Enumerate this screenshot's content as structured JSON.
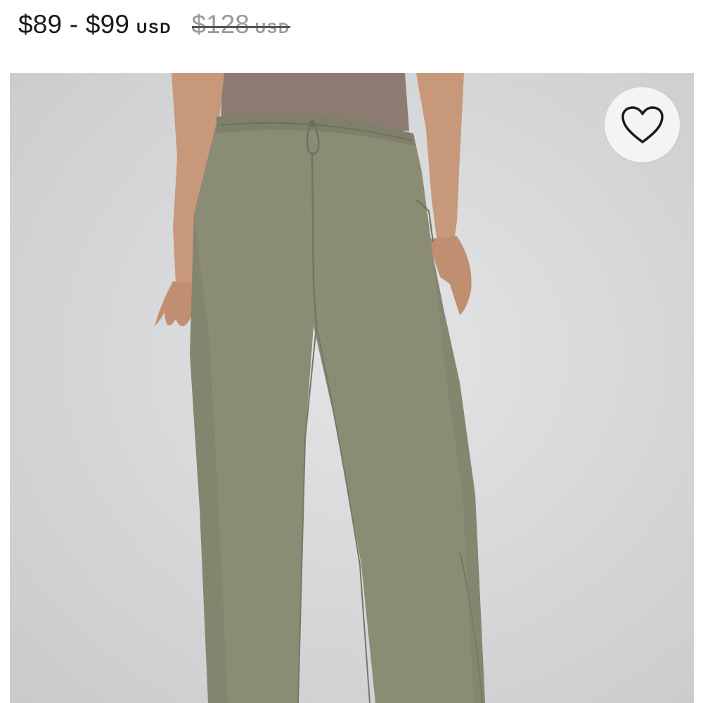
{
  "price": {
    "current": "$89 - $99",
    "current_currency": "USD",
    "original": "$128",
    "original_currency": "USD"
  },
  "wishlist": {
    "icon": "heart-outline-icon"
  },
  "colors": {
    "pant": "#8a8c74",
    "background": "#d5d6d8",
    "top": "#8b7b70",
    "strikethrough": "#9a9a9a"
  }
}
